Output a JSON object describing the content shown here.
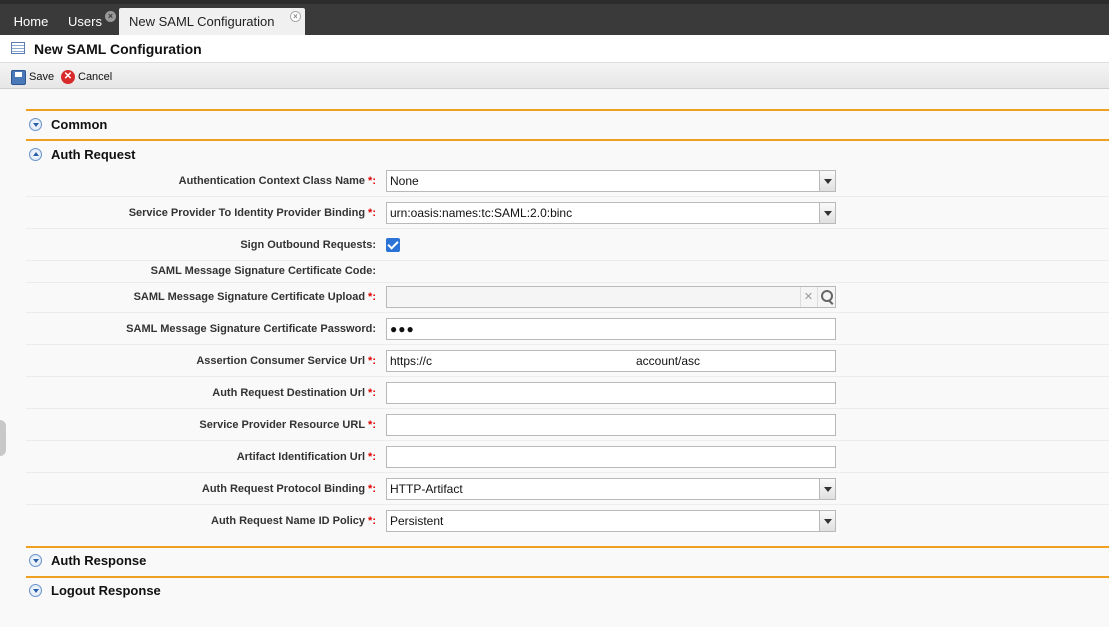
{
  "tabs": [
    {
      "label": "Home"
    },
    {
      "label": "Users",
      "close": "×"
    },
    {
      "label": "New SAML Configuration",
      "close": "×"
    }
  ],
  "title": "New SAML Configuration",
  "toolbar": {
    "save_label": "Save",
    "cancel_label": "Cancel",
    "cancel_glyph": "✕"
  },
  "sections": {
    "common": "Common",
    "auth_request": "Auth Request",
    "auth_response": "Auth Response",
    "logout_response": "Logout Response"
  },
  "required_mark": "*:",
  "form": {
    "auth_context_class": {
      "label": "Authentication Context Class Name",
      "value": "None"
    },
    "sp_idp_binding": {
      "label": "Service Provider To Identity Provider Binding",
      "value": "urn:oasis:names:tc:SAML:2.0:binc"
    },
    "sign_outbound": {
      "label": "Sign Outbound Requests:",
      "checked": true
    },
    "cert_code": {
      "label": "SAML Message Signature Certificate Code:"
    },
    "cert_upload": {
      "label": "SAML Message Signature Certificate Upload",
      "value": "",
      "clear_glyph": "✕"
    },
    "cert_password": {
      "label": "SAML Message Signature Certificate Password:",
      "value": "●●●"
    },
    "acs_url": {
      "label": "Assertion Consumer Service Url",
      "value_start": "https://c",
      "value_end": "account/asc"
    },
    "destination_url": {
      "label": "Auth Request Destination Url",
      "value": ""
    },
    "sp_resource_url": {
      "label": "Service Provider Resource URL",
      "value": ""
    },
    "artifact_url": {
      "label": "Artifact Identification Url",
      "value": ""
    },
    "protocol_binding": {
      "label": "Auth Request Protocol Binding",
      "value": "HTTP-Artifact"
    },
    "name_id_policy": {
      "label": "Auth Request Name ID Policy",
      "value": "Persistent"
    }
  }
}
